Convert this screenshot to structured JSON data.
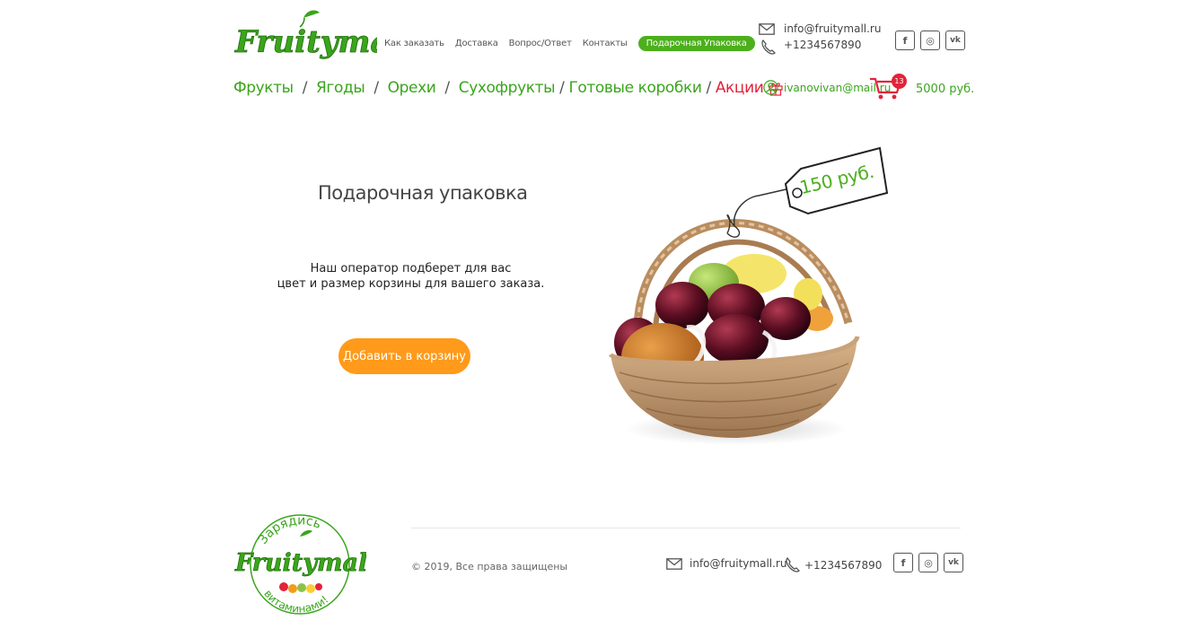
{
  "brand": {
    "name": "Fruitymall"
  },
  "topnav": {
    "items": [
      {
        "label": "Как заказать"
      },
      {
        "label": "Доставка"
      },
      {
        "label": "Вопрос/Ответ"
      },
      {
        "label": "Контакты"
      },
      {
        "label": "Подарочная Упаковка",
        "active": true
      }
    ]
  },
  "contacts": {
    "email": "info@fruitymall.ru",
    "phone": "+1234567890"
  },
  "social": {
    "icons": [
      "facebook-icon",
      "instagram-icon",
      "vk-icon"
    ]
  },
  "catnav": {
    "items": [
      {
        "label": "Фрукты"
      },
      {
        "label": "Ягоды"
      },
      {
        "label": "Орехи"
      },
      {
        "label": "Сухофрукты"
      },
      {
        "label": "Готовые коробки"
      },
      {
        "label": "Акции"
      }
    ],
    "separator": "/"
  },
  "user": {
    "email": "ivanovivan@mail.ru"
  },
  "cart": {
    "count": "13",
    "sum": "5000 руб."
  },
  "product": {
    "title": "Подарочная упаковка",
    "description_line1": "Наш оператор подберет для вас",
    "description_line2": "цвет и размер корзины для вашего заказа.",
    "price": "150 руб.",
    "add_button": "Добавить в корзину"
  },
  "footer": {
    "badge_top": "Зарядись",
    "badge_bottom": "витаминами!",
    "copyright": "© 2019, Все права защищены",
    "email": "info@fruitymall.ru",
    "phone": "+1234567890"
  },
  "colors": {
    "accent_green": "#3aa51c",
    "pill_green": "#4caf1c",
    "promo_red": "#e2233a",
    "button_orange": "#ff9a1a"
  }
}
